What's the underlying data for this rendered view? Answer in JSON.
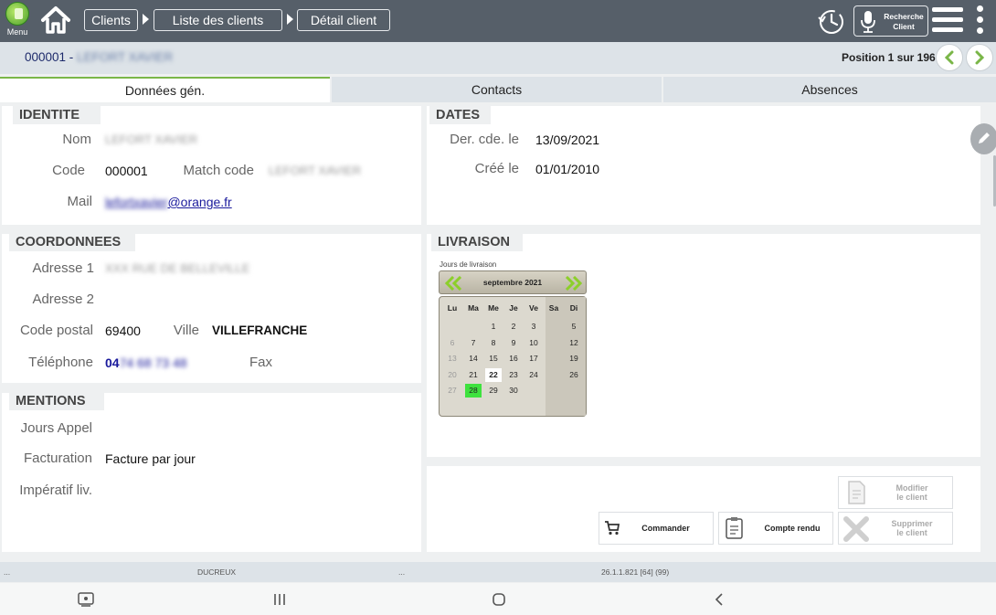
{
  "topbar": {
    "menu_label": "Menu",
    "breadcrumbs": [
      "Clients",
      "Liste des clients",
      "Détail client"
    ],
    "search_client_label_1": "Recherche",
    "search_client_label_2": "Client"
  },
  "subheader": {
    "client_code": "000001 -",
    "client_name_redacted": "LEFORT XAVIER",
    "position": "Position 1 sur 196"
  },
  "tabs": [
    "Données gén.",
    "Contacts",
    "Absences"
  ],
  "identite": {
    "title": "IDENTITE",
    "nom_label": "Nom",
    "nom_value": "LEFORT XAVIER",
    "code_label": "Code",
    "code_value": "000001",
    "match_code_label": "Match code",
    "match_code_value": "LEFORT XAVIER",
    "mail_label": "Mail",
    "mail_user": "lefortxavier",
    "mail_domain": "@orange.fr"
  },
  "dates": {
    "title": "DATES",
    "der_cde_label": "Der. cde. le",
    "der_cde_value": "13/09/2021",
    "cree_label": "Créé le",
    "cree_value": "01/01/2010"
  },
  "coordonnees": {
    "title": "COORDONNEES",
    "adresse1_label": "Adresse 1",
    "adresse1_value": "XXX RUE DE BELLEVILLE",
    "adresse2_label": "Adresse 2",
    "code_postal_label": "Code postal",
    "code_postal_value": "69400",
    "ville_label": "Ville",
    "ville_value": "VILLEFRANCHE",
    "telephone_label": "Téléphone",
    "telephone_prefix": "04",
    "telephone_rest": "74 68 73 48",
    "fax_label": "Fax"
  },
  "livraison": {
    "title": "LIVRAISON",
    "caption": "Jours de livraison",
    "month": "septembre 2021",
    "days_of_week": [
      "Lu",
      "Ma",
      "Me",
      "Je",
      "Ve",
      "Sa",
      "Di"
    ],
    "weeks": [
      [
        "",
        "",
        "1",
        "2",
        "3",
        "",
        "5"
      ],
      [
        "6",
        "7",
        "8",
        "9",
        "10",
        "",
        "12"
      ],
      [
        "13",
        "14",
        "15",
        "16",
        "17",
        "",
        "19"
      ],
      [
        "20",
        "21",
        "22",
        "23",
        "24",
        "",
        "26"
      ],
      [
        "27",
        "28",
        "29",
        "30",
        "",
        "",
        ""
      ]
    ],
    "today": "22",
    "selected": "28",
    "muted_days": [
      "6",
      "13",
      "20",
      "27"
    ]
  },
  "mentions": {
    "title": "MENTIONS",
    "jours_appel_label": "Jours Appel",
    "facturation_label": "Facturation",
    "facturation_value": "Facture par jour",
    "imperatif_label": "Impératif liv."
  },
  "actions": {
    "commander": "Commander",
    "compte_rendu": "Compte rendu",
    "modifier_1": "Modifier",
    "modifier_2": "le client",
    "supprimer_1": "Supprimer",
    "supprimer_2": "le client"
  },
  "statusbar": {
    "left": "...",
    "user": "DUCREUX",
    "mid": "...",
    "version": "26.1.1.821 [64] (99)"
  },
  "colors": {
    "topbar": "#565f69",
    "accent_green": "#7ab648",
    "link_blue": "#1a1a9c",
    "selected_day": "#3ee23e"
  }
}
